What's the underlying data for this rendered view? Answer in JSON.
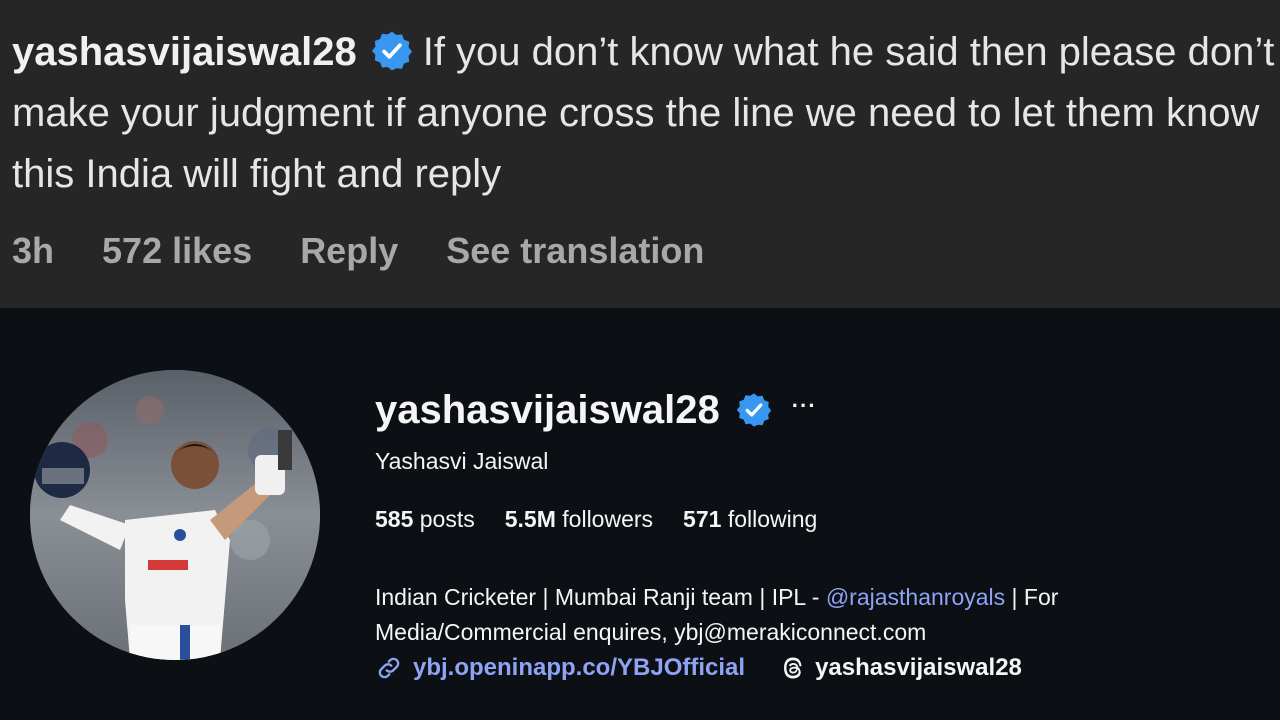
{
  "comment": {
    "username": "yashasvijaiswal28",
    "text": "If you don’t know what he said then please don’t make your judgment if anyone cross the line we need to let them know this India will fight and reply",
    "time": "3h",
    "likes": "572 likes",
    "reply": "Reply",
    "translate": "See translation"
  },
  "profile": {
    "username": "yashasvijaiswal28",
    "more": "···",
    "full_name": "Yashasvi Jaiswal",
    "posts_count": "585",
    "posts_label": "posts",
    "followers_count": "5.5M",
    "followers_label": "followers",
    "following_count": "571",
    "following_label": "following",
    "bio_part1": "Indian Cricketer | Mumbai Ranji team | IPL - ",
    "bio_mention": "@rajasthanroyals",
    "bio_part2": " | For Media/Commercial enquires, ybj@merakiconnect.com",
    "website": "ybj.openinapp.co/YBJOfficial",
    "threads_handle": "yashasvijaiswal28"
  },
  "colors": {
    "verified": "#3897f0",
    "link": "#8fa3f5",
    "comment_bg": "#262626",
    "profile_bg": "#0c1014"
  },
  "icons": {
    "verified": "verified-badge-icon",
    "more": "more-options-icon",
    "link": "link-icon",
    "threads": "threads-icon"
  }
}
